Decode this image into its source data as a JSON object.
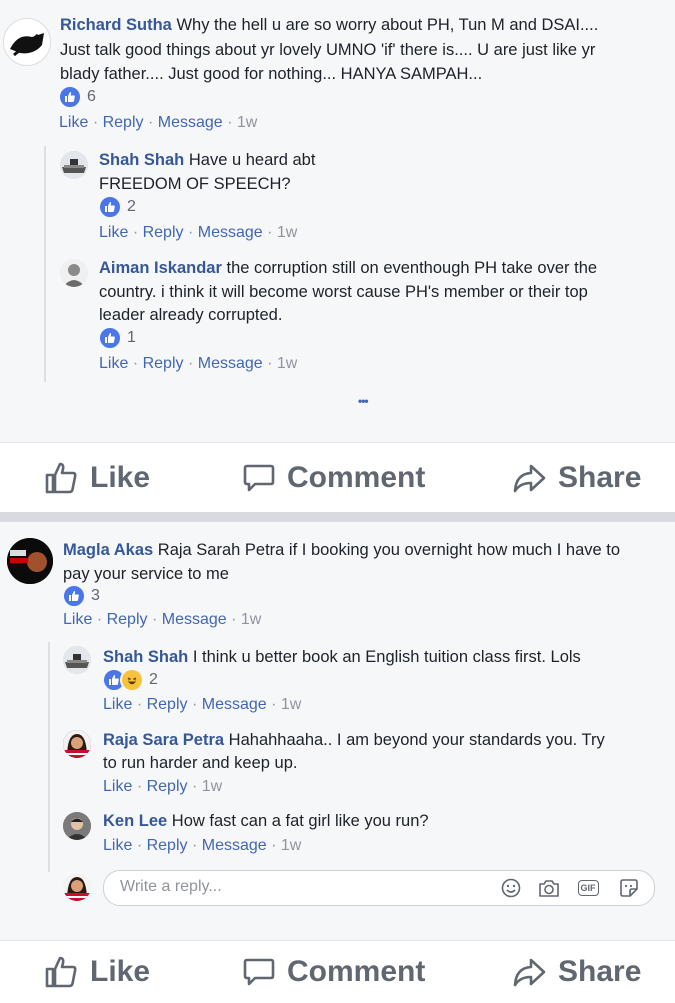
{
  "post1": {
    "comment": {
      "author": "Richard Sutha",
      "text_line1": "Why the hell u are so worry about PH, Tun M and DSAI....",
      "text_line2": "Just talk good things about yr lovely UMNO 'if' there is.... U are just like yr",
      "text_line3": "blady father.... Just good for nothing... HANYA SAMPAH...",
      "reactions": "6",
      "time": "1w"
    },
    "replies": [
      {
        "author": "Shah Shah",
        "text_line1": "Have u heard abt",
        "text_line2": "FREEDOM OF SPEECH?",
        "reactions": "2",
        "time": "1w"
      },
      {
        "author": "Aiman Iskandar",
        "text_line1": "the corruption still on eventhough PH take over the",
        "text_line2": "country. i think it will become worst cause PH's member or their top",
        "text_line3": "leader already corrupted.",
        "reactions": "1",
        "time": "1w"
      }
    ],
    "more": "•••"
  },
  "post2": {
    "comment": {
      "author": "Magla Akas",
      "text_line1": "Raja Sarah Petra if I booking you overnight how much I have to",
      "text_line2": "pay your service to me",
      "reactions": "3",
      "time": "1w"
    },
    "replies": [
      {
        "author": "Shah Shah",
        "text_line1": "I think u better book an English tuition class first. Lols",
        "reactions": "2",
        "time": "1w"
      },
      {
        "author": "Raja Sara Petra",
        "text_line1": "Hahahhaaha.. I am beyond your standards you. Try",
        "text_line2": "to run harder and keep up.",
        "time": "1w"
      },
      {
        "author": "Ken Lee",
        "text_line1": "How fast can a fat girl like you run?",
        "time": "1w"
      }
    ],
    "reply_placeholder": "Write a reply..."
  },
  "labels": {
    "like": "Like",
    "reply": "Reply",
    "message": "Message",
    "sep": "·",
    "action_like": "Like",
    "action_comment": "Comment",
    "action_share": "Share",
    "gif": "GIF"
  },
  "colors": {
    "link": "#365899",
    "like_blue": "#4a76e8",
    "haha_yellow": "#f7c33d",
    "action_grey": "#606770"
  },
  "icons": [
    "thumbs-up-icon",
    "comment-bubble-icon",
    "share-arrow-icon",
    "emoji-icon",
    "camera-icon",
    "gif-icon",
    "sticker-icon"
  ]
}
